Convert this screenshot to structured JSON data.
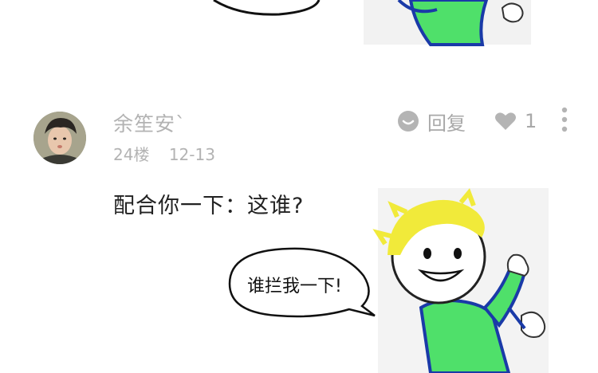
{
  "post": {
    "username": "余笙安`",
    "floor": "24楼",
    "date": "12-13",
    "reply_label": "回复",
    "like_count": "1",
    "text": "配合你一下：这谁?"
  },
  "sticker": {
    "caption": "谁拦我一下!"
  },
  "icons": {
    "reply": "reply-bubble-icon",
    "like": "heart-icon",
    "more": "more-vertical-icon"
  }
}
